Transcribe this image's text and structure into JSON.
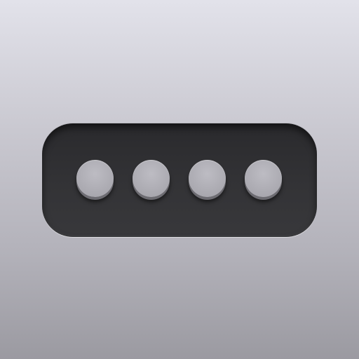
{
  "icon": {
    "name": "password-dots-icon",
    "colors": {
      "background_top": "#e2e2ea",
      "background_bottom": "#9b9aa1",
      "field": "#333336",
      "dot": "#b4b3ba"
    },
    "masked_character_count": 4
  }
}
